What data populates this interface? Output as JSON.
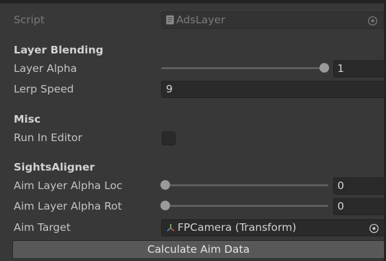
{
  "script_row": {
    "label": "Script",
    "value": "AdsLayer"
  },
  "layer_blending": {
    "header": "Layer Blending",
    "layer_alpha": {
      "label": "Layer Alpha",
      "value": "1",
      "fraction": 1.0
    },
    "lerp_speed": {
      "label": "Lerp Speed",
      "value": "9"
    }
  },
  "misc": {
    "header": "Misc",
    "run_in_editor": {
      "label": "Run In Editor",
      "checked": false
    }
  },
  "sights_aligner": {
    "header": "SightsAligner",
    "aim_layer_alpha_loc": {
      "label": "Aim Layer Alpha Loc",
      "value": "0",
      "fraction": 0.0
    },
    "aim_layer_alpha_rot": {
      "label": "Aim Layer Alpha Rot",
      "value": "0",
      "fraction": 0.0
    },
    "aim_target": {
      "label": "Aim Target",
      "value": "FPCamera (Transform)"
    }
  },
  "calculate_button": {
    "label": "Calculate Aim Data"
  },
  "colors": {
    "background": "#383838",
    "field": "#2a2a2a",
    "button": "#585858",
    "slider_thumb": "#9a9a9a"
  },
  "icons": {
    "script_icon": "script-file-icon",
    "picker_icon": "object-picker-icon",
    "transform_icon": "transform-axes-icon"
  }
}
